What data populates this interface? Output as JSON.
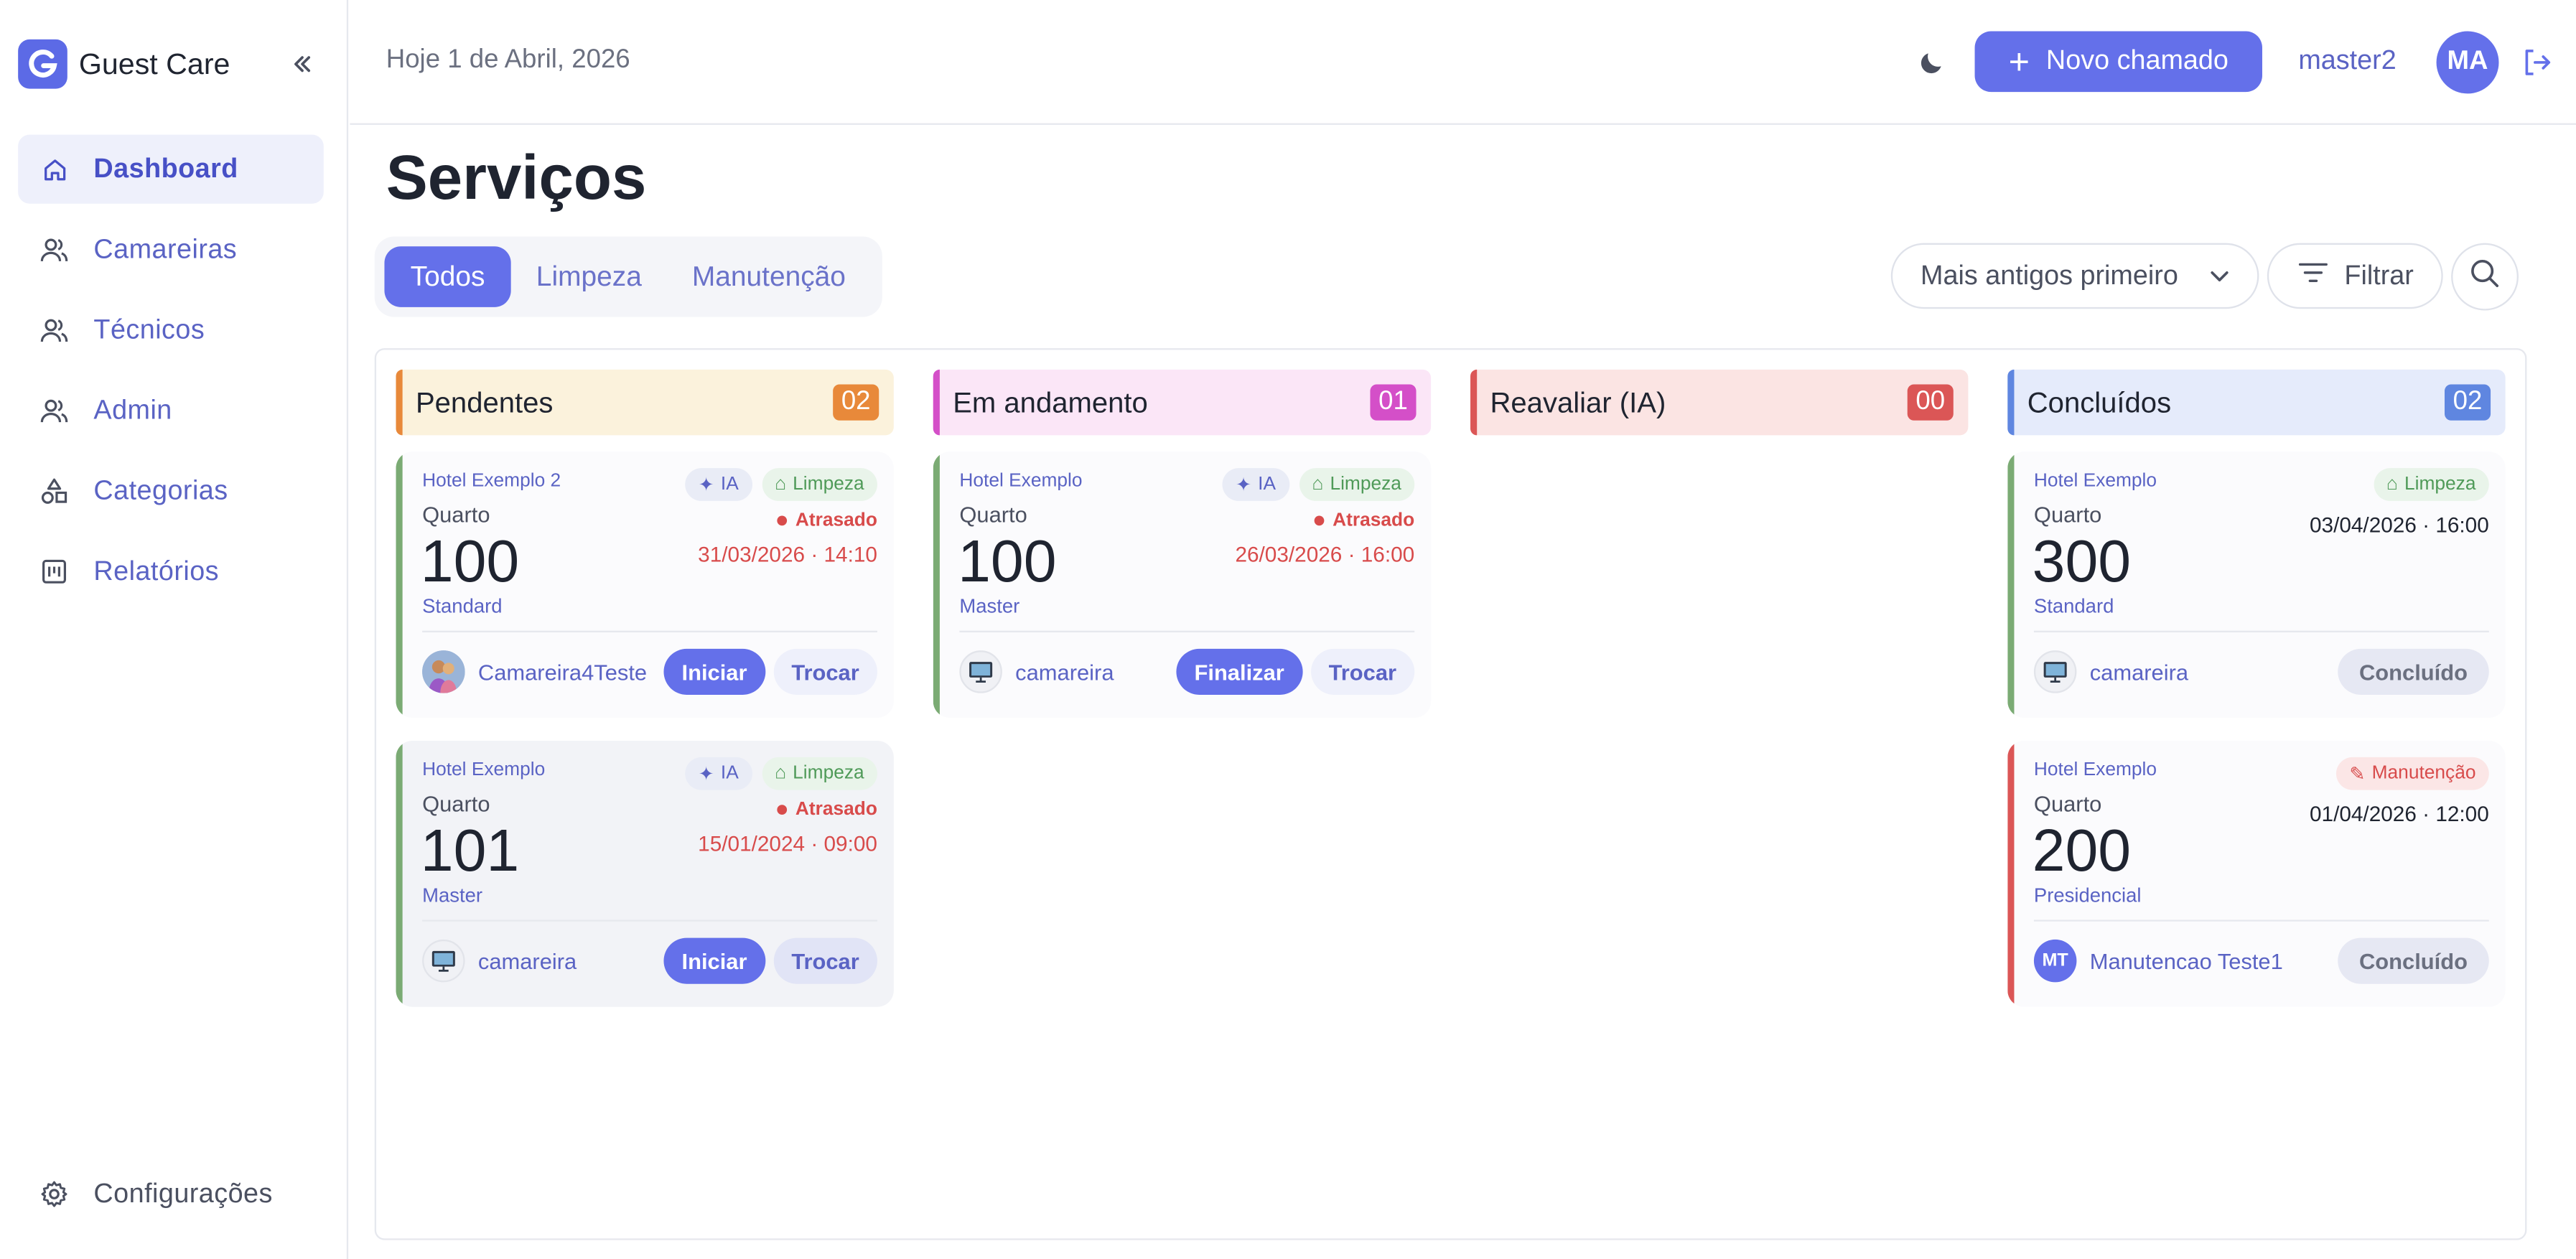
{
  "app": {
    "name": "Guest Care",
    "logo_letter": "G"
  },
  "sidebar": {
    "items": [
      {
        "label": "Dashboard",
        "icon": "home-icon",
        "active": true
      },
      {
        "label": "Camareiras",
        "icon": "users-icon"
      },
      {
        "label": "Técnicos",
        "icon": "users-icon"
      },
      {
        "label": "Admin",
        "icon": "users-icon"
      },
      {
        "label": "Categorias",
        "icon": "shapes-icon"
      },
      {
        "label": "Relatórios",
        "icon": "report-icon"
      }
    ],
    "settings_label": "Configurações"
  },
  "header": {
    "date": "Hoje 1 de Abril, 2026",
    "new_button": "Novo chamado",
    "username": "master2",
    "avatar_initials": "MA"
  },
  "page": {
    "title": "Serviços",
    "tabs": [
      "Todos",
      "Limpeza",
      "Manutenção"
    ],
    "active_tab": "Todos",
    "sort_label": "Mais antigos primeiro",
    "filter_label": "Filtrar"
  },
  "colors": {
    "accent": "#6470ea",
    "pendentes": "#e8893a",
    "em_andamento": "#d44fc8",
    "reavaliar": "#db5656",
    "concluidos": "#5f86e0"
  },
  "columns": [
    {
      "title": "Pendentes",
      "count": "02",
      "cards": [
        {
          "hotel": "Hotel Exemplo 2",
          "tags": [
            "IA",
            "Limpeza"
          ],
          "quarto_label": "Quarto",
          "number": "100",
          "type": "Standard",
          "status": "Atrasado",
          "datetime": "31/03/2026 · 14:10",
          "assignee": "Camareira4Teste",
          "primary_action": "Iniciar",
          "secondary_action": "Trocar"
        },
        {
          "hotel": "Hotel Exemplo",
          "tags": [
            "IA",
            "Limpeza"
          ],
          "quarto_label": "Quarto",
          "number": "101",
          "type": "Master",
          "status": "Atrasado",
          "datetime": "15/01/2024 · 09:00",
          "assignee": "camareira",
          "primary_action": "Iniciar",
          "secondary_action": "Trocar"
        }
      ]
    },
    {
      "title": "Em andamento",
      "count": "01",
      "cards": [
        {
          "hotel": "Hotel Exemplo",
          "tags": [
            "IA",
            "Limpeza"
          ],
          "quarto_label": "Quarto",
          "number": "100",
          "type": "Master",
          "status": "Atrasado",
          "datetime": "26/03/2026 · 16:00",
          "assignee": "camareira",
          "primary_action": "Finalizar",
          "secondary_action": "Trocar"
        }
      ]
    },
    {
      "title": "Reavaliar (IA)",
      "count": "00",
      "cards": []
    },
    {
      "title": "Concluídos",
      "count": "02",
      "cards": [
        {
          "hotel": "Hotel Exemplo",
          "tags": [
            "Limpeza"
          ],
          "quarto_label": "Quarto",
          "number": "300",
          "type": "Standard",
          "datetime": "03/04/2026 · 16:00",
          "assignee": "camareira",
          "done_label": "Concluído"
        },
        {
          "hotel": "Hotel Exemplo",
          "tags": [
            "Manutenção"
          ],
          "quarto_label": "Quarto",
          "number": "200",
          "type": "Presidencial",
          "datetime": "01/04/2026 · 12:00",
          "assignee": "Manutencao Teste1",
          "assignee_initials": "MT",
          "done_label": "Concluído"
        }
      ]
    }
  ]
}
